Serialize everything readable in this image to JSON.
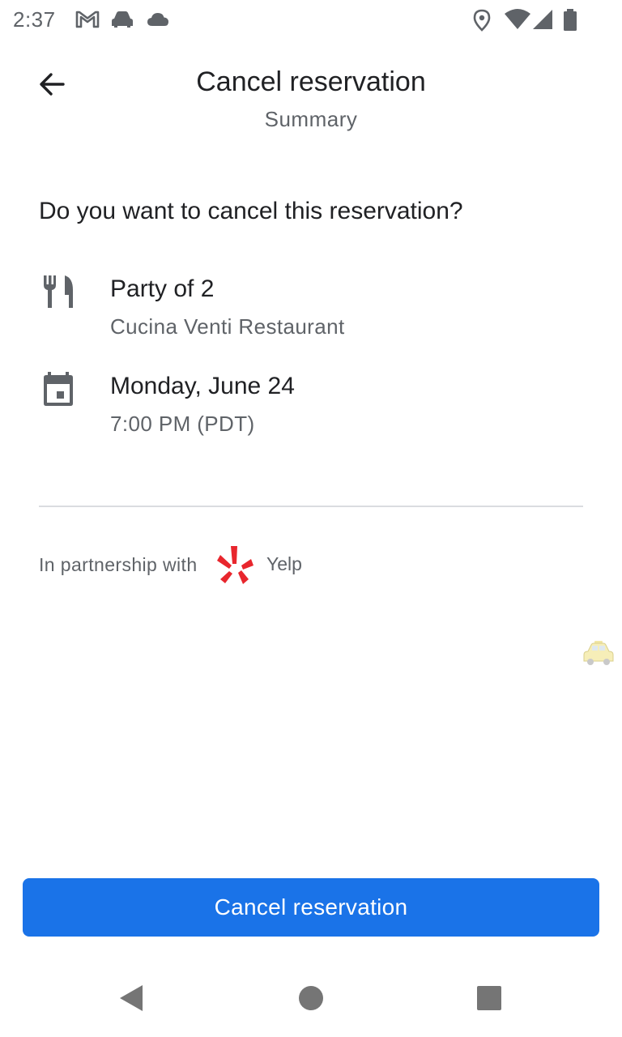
{
  "status_bar": {
    "time": "2:37",
    "left_icons": [
      "gmail-icon",
      "car-icon",
      "cloud-icon"
    ],
    "right_icons": [
      "location-icon",
      "wifi-icon",
      "signal-icon",
      "battery-icon"
    ]
  },
  "header": {
    "title": "Cancel reservation",
    "subtitle": "Summary",
    "back_icon": "arrow-back-icon"
  },
  "main": {
    "question": "Do you want to cancel this reservation?",
    "party": {
      "icon": "restaurant-icon",
      "primary": "Party of 2",
      "secondary": "Cucina Venti Restaurant"
    },
    "date": {
      "icon": "calendar-icon",
      "primary": "Monday, June 24",
      "secondary": "7:00 PM (PDT)"
    },
    "partnership": {
      "text": "In partnership with",
      "logo_icon": "yelp-logo-icon",
      "partner_name": "Yelp"
    },
    "floating_icon": "taxi-icon"
  },
  "action": {
    "cancel_label": "Cancel reservation"
  },
  "nav": {
    "back": "nav-back-icon",
    "home": "nav-home-icon",
    "recents": "nav-recents-icon"
  },
  "colors": {
    "accent": "#1a73e8",
    "text_primary": "#202124",
    "text_secondary": "#5f6368",
    "divider": "#dadce0",
    "yelp_red": "#e8262d"
  }
}
